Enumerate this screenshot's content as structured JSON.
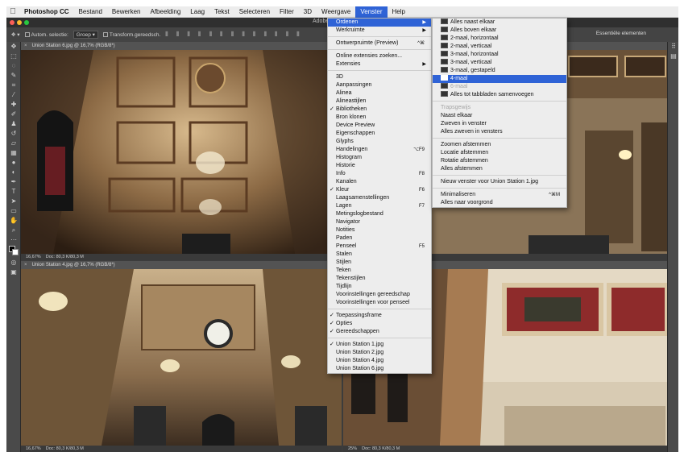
{
  "menubar": {
    "items": [
      "Photoshop CC",
      "Bestand",
      "Bewerken",
      "Afbeelding",
      "Laag",
      "Tekst",
      "Selecteren",
      "Filter",
      "3D",
      "Weergave",
      "Venster",
      "Help"
    ]
  },
  "window": {
    "title": "Adobe"
  },
  "options_bar": {
    "auto_select": "Autom. selectie:",
    "group": "Groep",
    "transform": "Transform.gereedsch.",
    "workspace": "Essentiële elementen"
  },
  "documents": [
    {
      "tab": "Union Station 6.jpg @ 16,7% (RGB/8*)",
      "zoom": "16,67%",
      "doc": "Doc: 80,3 K/80,3 M"
    },
    {
      "tab": "Union Station 4.jpg @ 16,7% (RGB/8*)",
      "zoom": "16,67%",
      "doc": "Doc: 80,3 K/80,3 M"
    },
    {
      "tab": "",
      "zoom": "",
      "doc": ""
    },
    {
      "tab": "",
      "zoom": "25%",
      "doc": "Doc: 80,3 K/80,3 M"
    }
  ],
  "venster_menu": {
    "ordenen": "Ordenen",
    "werkruimte": "Werkruimte",
    "ontwerpruimte": "Ontwerpruimte (Preview)",
    "ontwerpruimte_sc": "^⌘",
    "online_ext": "Online extensies zoeken...",
    "extensies": "Extensies",
    "panels": [
      {
        "label": "3D",
        "check": "",
        "sc": ""
      },
      {
        "label": "Aanpassingen",
        "check": "",
        "sc": ""
      },
      {
        "label": "Alinea",
        "check": "",
        "sc": ""
      },
      {
        "label": "Alineastijlen",
        "check": "",
        "sc": ""
      },
      {
        "label": "Bibliotheken",
        "check": "✓",
        "sc": ""
      },
      {
        "label": "Bron klonen",
        "check": "",
        "sc": ""
      },
      {
        "label": "Device Preview",
        "check": "",
        "sc": ""
      },
      {
        "label": "Eigenschappen",
        "check": "",
        "sc": ""
      },
      {
        "label": "Glyphs",
        "check": "",
        "sc": ""
      },
      {
        "label": "Handelingen",
        "check": "",
        "sc": "⌥F9"
      },
      {
        "label": "Histogram",
        "check": "",
        "sc": ""
      },
      {
        "label": "Historie",
        "check": "",
        "sc": ""
      },
      {
        "label": "Info",
        "check": "",
        "sc": "F8"
      },
      {
        "label": "Kanalen",
        "check": "",
        "sc": ""
      },
      {
        "label": "Kleur",
        "check": "✓",
        "sc": "F6"
      },
      {
        "label": "Laagsamenstellingen",
        "check": "",
        "sc": ""
      },
      {
        "label": "Lagen",
        "check": "",
        "sc": "F7"
      },
      {
        "label": "Metingslogbestand",
        "check": "",
        "sc": ""
      },
      {
        "label": "Navigator",
        "check": "",
        "sc": ""
      },
      {
        "label": "Notities",
        "check": "",
        "sc": ""
      },
      {
        "label": "Paden",
        "check": "",
        "sc": ""
      },
      {
        "label": "Penseel",
        "check": "",
        "sc": "F5"
      },
      {
        "label": "Stalen",
        "check": "",
        "sc": ""
      },
      {
        "label": "Stijlen",
        "check": "",
        "sc": ""
      },
      {
        "label": "Teken",
        "check": "",
        "sc": ""
      },
      {
        "label": "Tekenstijlen",
        "check": "",
        "sc": ""
      },
      {
        "label": "Tijdlijn",
        "check": "",
        "sc": ""
      },
      {
        "label": "Voorinstellingen gereedschap",
        "check": "",
        "sc": ""
      },
      {
        "label": "Voorinstellingen voor penseel",
        "check": "",
        "sc": ""
      }
    ],
    "frames": [
      {
        "label": "Toepassingsframe",
        "check": "✓"
      },
      {
        "label": "Opties",
        "check": "✓"
      },
      {
        "label": "Gereedschappen",
        "check": "✓"
      }
    ],
    "files": [
      {
        "label": "Union Station 1.jpg",
        "check": "✓"
      },
      {
        "label": "Union Station 2.jpg",
        "check": ""
      },
      {
        "label": "Union Station 4.jpg",
        "check": ""
      },
      {
        "label": "Union Station 6.jpg",
        "check": ""
      }
    ]
  },
  "ordenen_menu": {
    "layouts": [
      {
        "label": "Alles naast elkaar",
        "state": "normal"
      },
      {
        "label": "Alles boven elkaar",
        "state": "normal"
      },
      {
        "label": "2-maal, horizontaal",
        "state": "normal"
      },
      {
        "label": "2-maal, verticaal",
        "state": "normal"
      },
      {
        "label": "3-maal, horizontaal",
        "state": "normal"
      },
      {
        "label": "3-maal, verticaal",
        "state": "normal"
      },
      {
        "label": "3-maal, gestapeld",
        "state": "normal"
      },
      {
        "label": "4-maal",
        "state": "active"
      },
      {
        "label": "6-maal",
        "state": "disabled"
      },
      {
        "label": "Alles tot tabbladen samenvoegen",
        "state": "normal"
      }
    ],
    "cascade": "Trapsgewijs",
    "float_items": [
      "Naast elkaar",
      "Zweven in venster",
      "Alles zweven in vensters"
    ],
    "match_items": [
      "Zoomen afstemmen",
      "Locatie afstemmen",
      "Rotatie afstemmen",
      "Alles afstemmen"
    ],
    "new_window": "Nieuw venster voor Union Station 1.jpg",
    "minimize": "Minimaliseren",
    "minimize_sc": "^⌘M",
    "bring_front": "Alles naar voorgrond"
  },
  "colors": {
    "menu_highlight": "#2f63d6",
    "ps_dark": "#3c3c3c",
    "panel": "#4a4a4a"
  }
}
